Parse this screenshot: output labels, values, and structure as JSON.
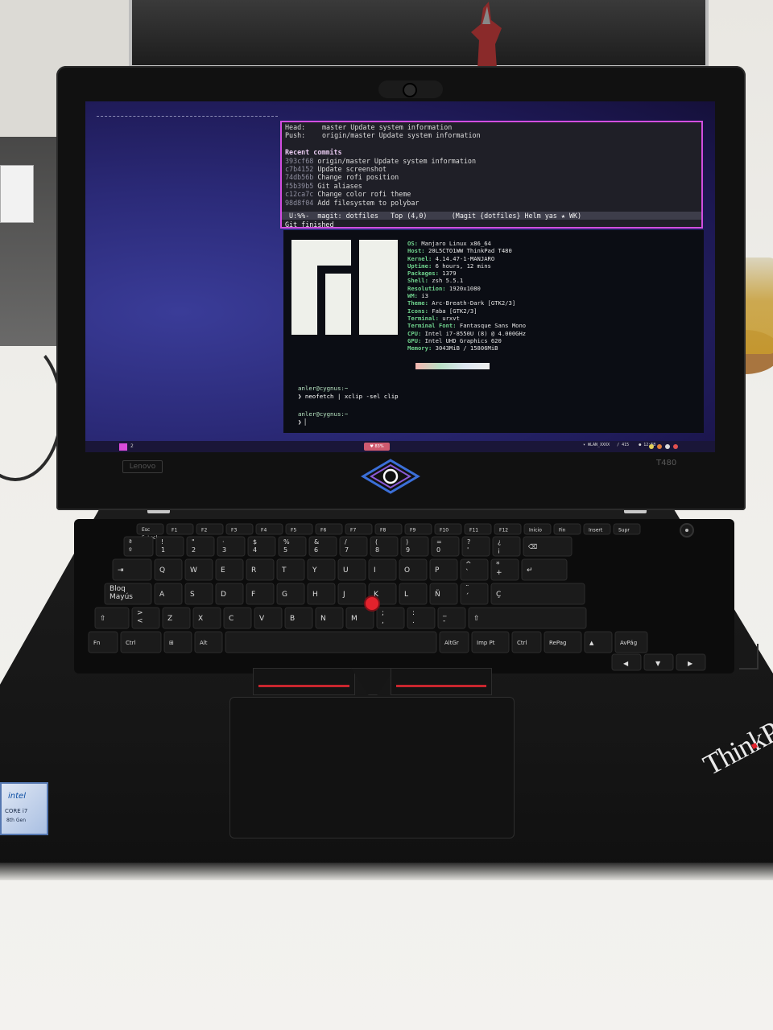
{
  "magit": {
    "head_label": "Head:",
    "head_value": "master Update system information",
    "push_label": "Push:",
    "push_value": "origin/master Update system information",
    "recent_commits_header": "Recent commits",
    "commits": [
      {
        "hash": "393cf68",
        "message": "origin/master Update system information"
      },
      {
        "hash": "c7b4152",
        "message": "Update screenshot"
      },
      {
        "hash": "74db56b",
        "message": "Change rofi position"
      },
      {
        "hash": "f5b39b5",
        "message": "Git aliases"
      },
      {
        "hash": "c12ca7c",
        "message": "Change color rofi theme"
      },
      {
        "hash": "98d8f04",
        "message": "Add filesystem to polybar"
      }
    ],
    "modeline": " U:%%-  magit: dotfiles   Top (4,0)      (Magit {dotfiles} Helm yas ★ WK)",
    "echo": "Git finished"
  },
  "neofetch": {
    "lines": [
      {
        "k": "OS:",
        "v": " Manjaro Linux x86_64"
      },
      {
        "k": "Host:",
        "v": " 20L5CTO1WW ThinkPad T480"
      },
      {
        "k": "Kernel:",
        "v": " 4.14.47-1-MANJARO"
      },
      {
        "k": "Uptime:",
        "v": " 6 hours, 12 mins"
      },
      {
        "k": "Packages:",
        "v": " 1379"
      },
      {
        "k": "Shell:",
        "v": " zsh 5.5.1"
      },
      {
        "k": "Resolution:",
        "v": " 1920x1080"
      },
      {
        "k": "WM:",
        "v": " i3"
      },
      {
        "k": "Theme:",
        "v": " Arc-Breath-Dark [GTK2/3]"
      },
      {
        "k": "Icons:",
        "v": " Faba [GTK2/3]"
      },
      {
        "k": "Terminal:",
        "v": " urxvt"
      },
      {
        "k": "Terminal Font:",
        "v": " Fantasque Sans Mono"
      },
      {
        "k": "CPU:",
        "v": " Intel i7-8550U (8) @ 4.000GHz"
      },
      {
        "k": "GPU:",
        "v": " Intel UHD Graphics 620"
      },
      {
        "k": "Memory:",
        "v": " 3043MiB / 15806MiB"
      }
    ],
    "prompt1": "anler@cygnus:~",
    "cmd1": "❯ neofetch | xclip -sel clip",
    "prompt2": "anler@cygnus:~",
    "cmd2": "❯ ▏"
  },
  "polybar": {
    "center": "♥ 83%",
    "right": "▾ WLAN_XXXX   / 415    ● 12:58"
  },
  "bezel": {
    "brand": "Lenovo",
    "model": "T480"
  },
  "keyboard": {
    "row0": [
      "Esc\nFnLock",
      "F1",
      "F2",
      "F3",
      "F4",
      "F5",
      "F6",
      "F7",
      "F8",
      "F9",
      "F10",
      "F11",
      "F12",
      "Inicio",
      "Fin",
      "Insert",
      "Supr"
    ],
    "row1": [
      "ª\nº",
      "!\n1",
      "\"\n2",
      "·\n3",
      "$\n4",
      "%\n5",
      "&\n6",
      "/\n7",
      "(\n8",
      ")\n9",
      "=\n0",
      "?\n'",
      "¿\n¡",
      "⌫"
    ],
    "row2": [
      "⇥",
      "Q",
      "W",
      "E",
      "R",
      "T",
      "Y",
      "U",
      "I",
      "O",
      "P",
      "^\n`",
      "*\n+",
      "↵"
    ],
    "row3": [
      "Bloq\nMayús",
      "A",
      "S",
      "D",
      "F",
      "G",
      "H",
      "J",
      "K",
      "L",
      "Ñ",
      "¨\n´",
      "Ç"
    ],
    "row4": [
      "⇧",
      ">\n<",
      "Z",
      "X",
      "C",
      "V",
      "B",
      "N",
      "M",
      ";\n,",
      ":\n.",
      "_\n-",
      "⇧"
    ],
    "row5": [
      "Fn",
      "Ctrl",
      "⊞",
      "Alt",
      "",
      "AltGr",
      "Imp Pt",
      "Ctrl",
      "RePag",
      "▲",
      "AvPág"
    ],
    "row6": [
      "◀",
      "▼",
      "▶"
    ]
  },
  "intel_badge": {
    "brand": "intel",
    "line1": "CORE i7",
    "line2": "8th Gen"
  },
  "thinkpad_brand": "ThinkPad"
}
